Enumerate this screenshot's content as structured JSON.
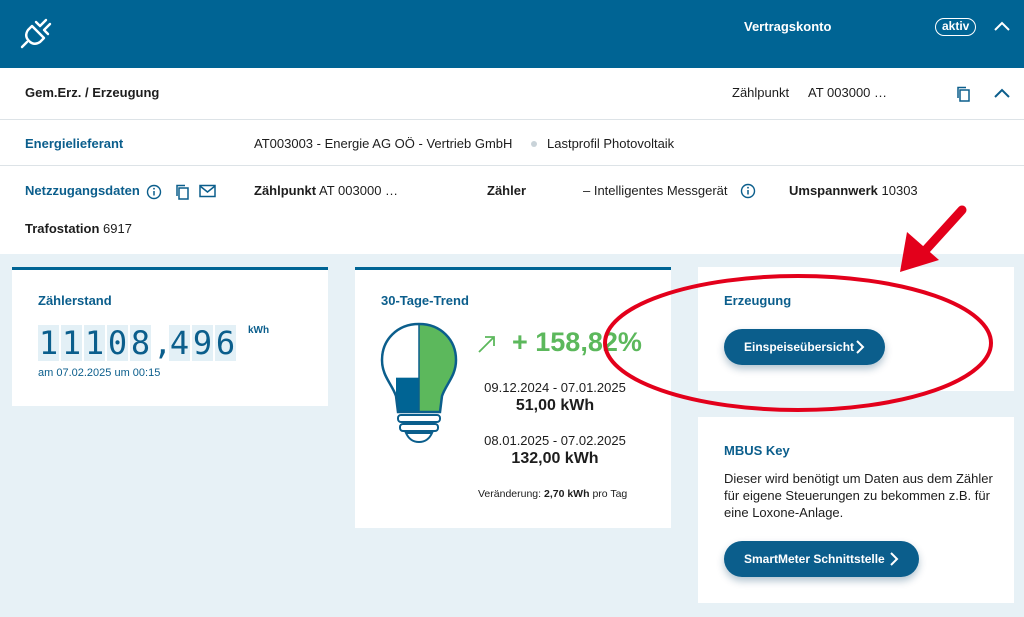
{
  "header": {
    "logo_icon": "plug-icon",
    "contract_label": "Vertragskonto",
    "status_badge": "aktiv"
  },
  "generation": {
    "title": "Gem.Erz. / Erzeugung",
    "metering_point_label": "Zählpunkt",
    "metering_point_value": "AT 003000 …"
  },
  "supplier": {
    "label": "Energielieferant",
    "value": "AT003003 - Energie AG OÖ - Vertrieb GmbH",
    "profile": "Lastprofil Photovoltaik"
  },
  "grid_access": {
    "label": "Netzzugangsdaten",
    "metering_point_label": "Zählpunkt",
    "metering_point_value": "AT 003000 …",
    "meter_label": "Zähler",
    "meter_value": "– Intelligentes Messgerät",
    "substation_label": "Umspannwerk",
    "substation_value": "10303",
    "transformer_label": "Trafostation",
    "transformer_value": "6917"
  },
  "meter_reading": {
    "title": "Zählerstand",
    "digits": [
      "1",
      "1",
      "1",
      "0",
      "8",
      ",",
      "4",
      "9",
      "6"
    ],
    "unit": "kWh",
    "timestamp": "am 07.02.2025 um 00:15"
  },
  "trend": {
    "title": "30-Tage-Trend",
    "percent": "+ 158,82%",
    "previous_period": "09.12.2024 - 07.01.2025",
    "previous_value": "51,00 kWh",
    "current_period": "08.01.2025 - 07.02.2025",
    "current_value": "132,00 kWh",
    "change_label": "Veränderung:",
    "change_value": "2,70 kWh",
    "change_suffix": "pro Tag",
    "bulb_previous_fill": 0.39,
    "bulb_current_fill": 1.0
  },
  "production": {
    "title": "Erzeugung",
    "button_label": "Einspeiseübersicht"
  },
  "mbus": {
    "title": "MBUS Key",
    "description": "Dieser wird benötigt um Daten aus dem Zähler für eigene Steuerungen zu bekommen z.B. für eine Loxone-Anlage.",
    "button_label": "SmartMeter Schnittstelle"
  },
  "colors": {
    "brand": "#006494",
    "accent_green": "#5cb85c",
    "annotation_red": "#e3001b"
  }
}
